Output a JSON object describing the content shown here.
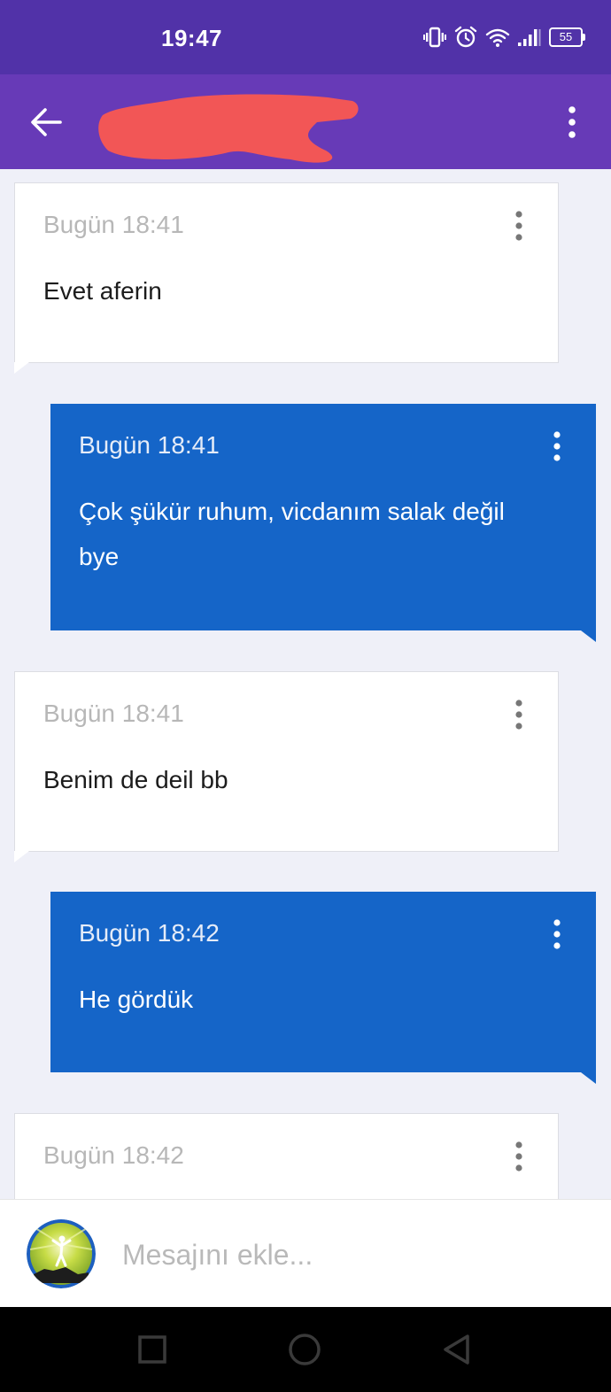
{
  "status_bar": {
    "time": "19:47",
    "icons": [
      "vibrate-icon",
      "alarm-icon",
      "wifi-icon",
      "signal-icon"
    ],
    "battery": "55"
  },
  "app_bar": {
    "title_redacted": true,
    "redaction_color": "#f25656",
    "background": "#673ab7"
  },
  "messages": [
    {
      "direction": "incoming",
      "time": "Bugün 18:41",
      "text": "Evet aferin"
    },
    {
      "direction": "outgoing",
      "time": "Bugün 18:41",
      "text": "Çok şükür ruhum, vicdanım salak değil bye"
    },
    {
      "direction": "incoming",
      "time": "Bugün 18:41",
      "text": "Benim de deil bb"
    },
    {
      "direction": "outgoing",
      "time": "Bugün 18:42",
      "text": "He gördük"
    },
    {
      "direction": "incoming",
      "time": "Bugün 18:42",
      "text": ""
    }
  ],
  "colors": {
    "incoming_bubble": "#ffffff",
    "outgoing_bubble": "#1565c8",
    "chat_background": "#eff0f8",
    "status_bar": "#5132a8"
  },
  "composer": {
    "placeholder": "Mesajını ekle...",
    "value": ""
  },
  "nav_bar": {
    "buttons": [
      "recent-apps-icon",
      "home-icon",
      "back-nav-icon"
    ]
  }
}
